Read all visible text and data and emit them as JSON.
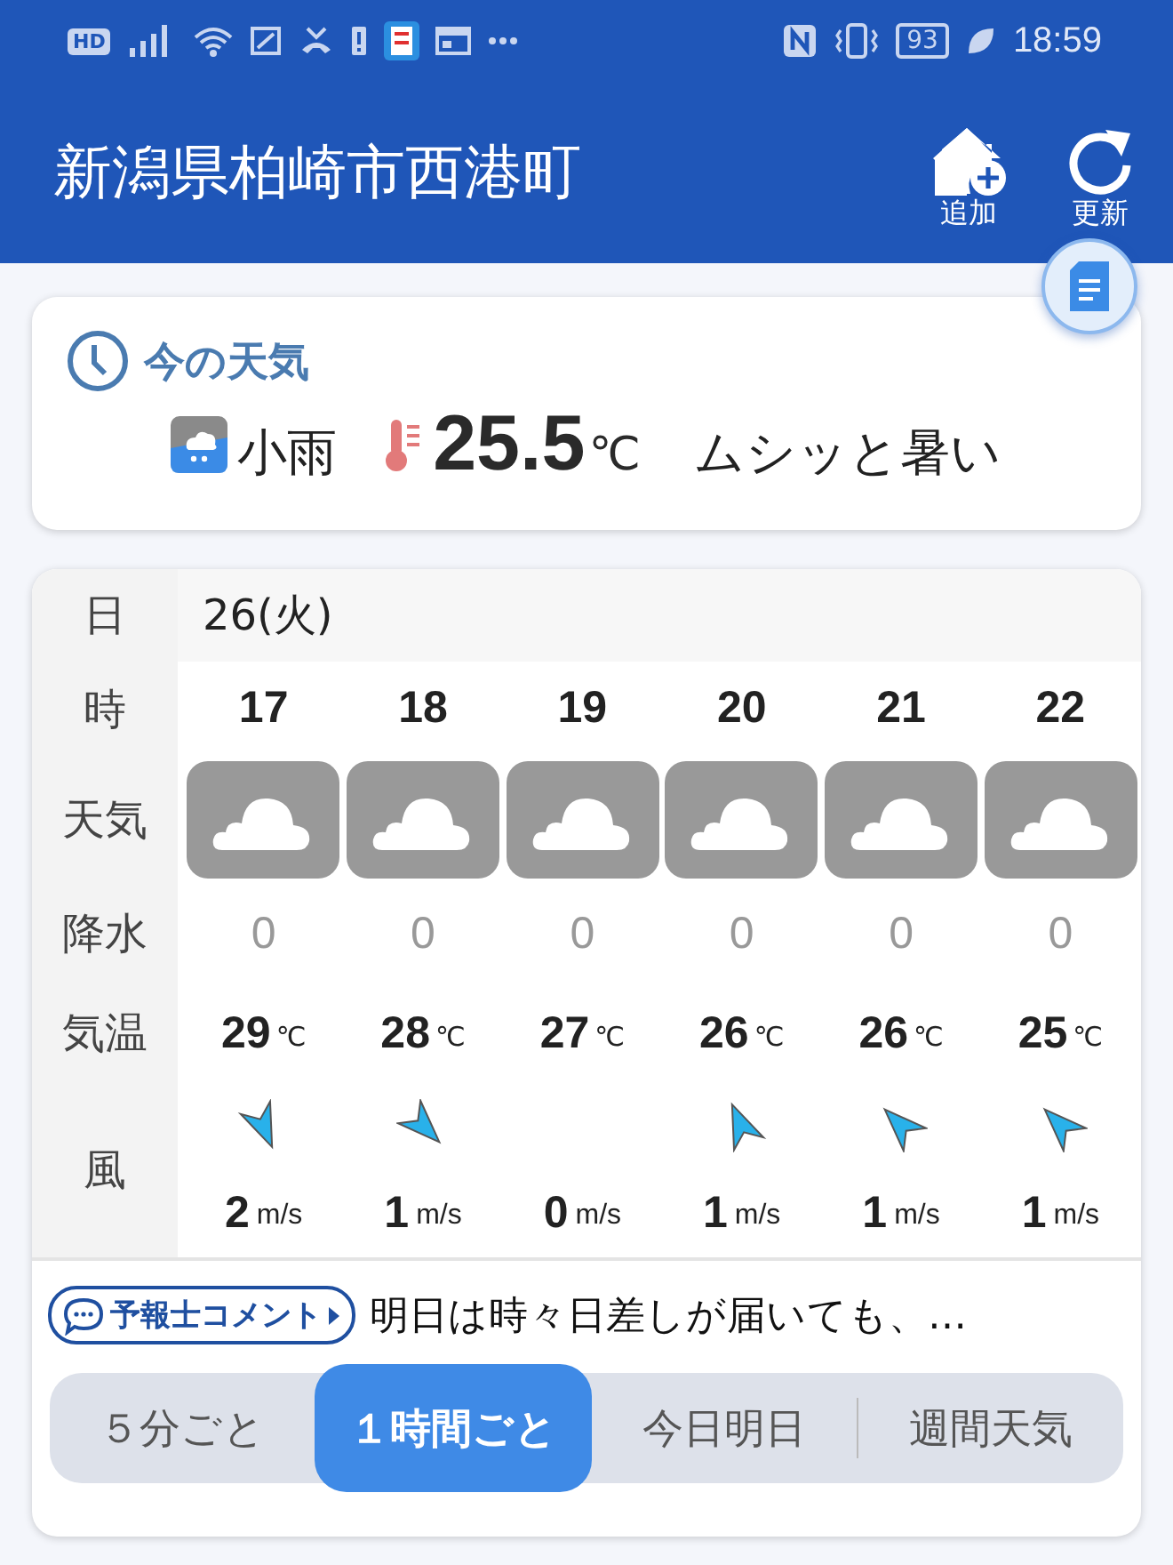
{
  "status_bar": {
    "left_badge": "HD",
    "battery": "93",
    "time": "18:59"
  },
  "header": {
    "title": "新潟県柏崎市西港町",
    "actions": [
      {
        "kind": "add",
        "label": "追加"
      },
      {
        "kind": "refresh",
        "label": "更新"
      }
    ]
  },
  "current": {
    "heading": "今の天気",
    "condition": "小雨",
    "temperature": "25.5",
    "unit": "℃",
    "feeling": "ムシッと暑い"
  },
  "forecast": {
    "labels": {
      "date": "日",
      "hour": "時",
      "weather": "天気",
      "precip": "降水",
      "temp": "気温",
      "wind": "風"
    },
    "date": "26(火)",
    "hours": [
      {
        "hour": "17",
        "precip": "0",
        "temp": "29",
        "temp_unit": "℃",
        "kind": "sse",
        "wind_speed": "2",
        "wind_unit": "m/s"
      },
      {
        "hour": "18",
        "precip": "0",
        "temp": "28",
        "temp_unit": "℃",
        "kind": "se",
        "wind_speed": "1",
        "wind_unit": "m/s"
      },
      {
        "hour": "19",
        "precip": "0",
        "temp": "27",
        "temp_unit": "℃",
        "kind": "calm",
        "wind_speed": "0",
        "wind_unit": "m/s"
      },
      {
        "hour": "20",
        "precip": "0",
        "temp": "26",
        "temp_unit": "℃",
        "kind": "nnw",
        "wind_speed": "1",
        "wind_unit": "m/s"
      },
      {
        "hour": "21",
        "precip": "0",
        "temp": "26",
        "temp_unit": "℃",
        "kind": "nw",
        "wind_speed": "1",
        "wind_unit": "m/s"
      },
      {
        "hour": "22",
        "precip": "0",
        "temp": "25",
        "temp_unit": "℃",
        "kind": "nw",
        "wind_speed": "1",
        "wind_unit": "m/s"
      }
    ]
  },
  "comment": {
    "badge": "予報士コメント",
    "text": "明日は時々日差しが届いても、…"
  },
  "tabs": [
    {
      "label": "５分ごと",
      "selected": false
    },
    {
      "label": "１時間ごと",
      "selected": true
    },
    {
      "label": "今日明日",
      "selected": false
    },
    {
      "label": "週間天気",
      "selected": false
    }
  ]
}
